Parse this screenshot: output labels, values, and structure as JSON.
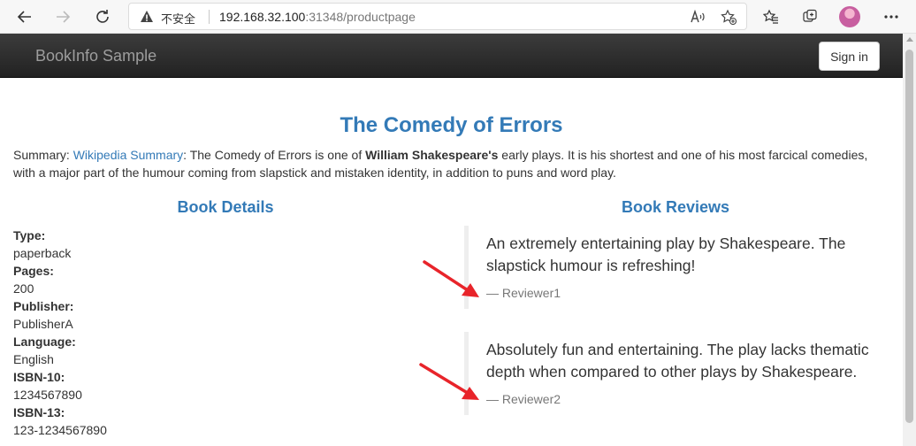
{
  "browser": {
    "security_label": "不安全",
    "url_host": "192.168.32.100",
    "url_rest": ":31348/productpage"
  },
  "navbar": {
    "brand": "BookInfo Sample",
    "signin_label": "Sign in"
  },
  "product": {
    "title": "The Comedy of Errors",
    "summary_prefix": "Summary: ",
    "summary_link": "Wikipedia Summary",
    "summary_mid": ": The Comedy of Errors is one of ",
    "summary_bold": "William Shakespeare's",
    "summary_rest": " early plays. It is his shortest and one of his most farcical comedies, with a major part of the humour coming from slapstick and mistaken identity, in addition to puns and word play."
  },
  "details": {
    "heading": "Book Details",
    "fields": [
      {
        "label": "Type:",
        "value": "paperback"
      },
      {
        "label": "Pages:",
        "value": "200"
      },
      {
        "label": "Publisher:",
        "value": "PublisherA"
      },
      {
        "label": "Language:",
        "value": "English"
      },
      {
        "label": "ISBN-10:",
        "value": "1234567890"
      },
      {
        "label": "ISBN-13:",
        "value": "123-1234567890"
      }
    ]
  },
  "reviews": {
    "heading": "Book Reviews",
    "items": [
      {
        "text": "An extremely entertaining play by Shakespeare. The slapstick humour is refreshing!",
        "author": "— Reviewer1"
      },
      {
        "text": "Absolutely fun and entertaining. The play lacks thematic depth when compared to other plays by Shakespeare.",
        "author": "— Reviewer2"
      }
    ]
  },
  "colors": {
    "link": "#337ab7",
    "navbar": "#222222",
    "arrow": "#e8242a"
  }
}
